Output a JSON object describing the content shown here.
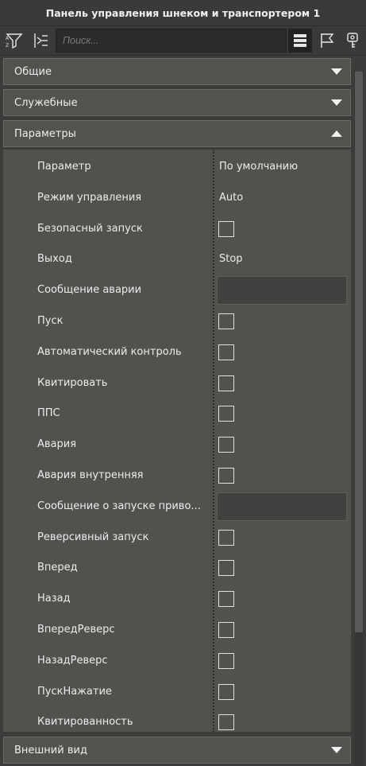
{
  "window": {
    "title": "Панель управления шнеком и транспортером 1"
  },
  "toolbar": {
    "search": {
      "placeholder": "Поиск..."
    },
    "buttons": [
      "sort-filter-icon",
      "expand-collapse-icon",
      "list-view-icon",
      "flag-icon",
      "key-icon"
    ]
  },
  "sections": {
    "general": {
      "label": "Общие",
      "expanded": false
    },
    "service": {
      "label": "Служебные",
      "expanded": false
    },
    "parameters": {
      "label": "Параметры",
      "expanded": true
    },
    "appearance": {
      "label": "Внешний вид",
      "expanded": false
    }
  },
  "grid": {
    "rows": [
      {
        "name": "Параметр",
        "type": "text",
        "value": "По умолчанию"
      },
      {
        "name": "Режим управления",
        "type": "text",
        "value": "Auto"
      },
      {
        "name": "Безопасный запуск",
        "type": "checkbox",
        "checked": false
      },
      {
        "name": "Выход",
        "type": "text",
        "value": "Stop"
      },
      {
        "name": "Сообщение аварии",
        "type": "field",
        "value": ""
      },
      {
        "name": "Пуск",
        "type": "checkbox",
        "checked": false
      },
      {
        "name": "Автоматический контроль",
        "type": "checkbox",
        "checked": false
      },
      {
        "name": "Квитировать",
        "type": "checkbox",
        "checked": false
      },
      {
        "name": "ППС",
        "type": "checkbox",
        "checked": false
      },
      {
        "name": "Авария",
        "type": "checkbox",
        "checked": false
      },
      {
        "name": "Авария внутренняя",
        "type": "checkbox",
        "checked": false
      },
      {
        "name": "Сообщение о запуске приво...",
        "type": "field",
        "value": ""
      },
      {
        "name": "Реверсивный запуск",
        "type": "checkbox",
        "checked": false
      },
      {
        "name": "Вперед",
        "type": "checkbox",
        "checked": false
      },
      {
        "name": "Назад",
        "type": "checkbox",
        "checked": false
      },
      {
        "name": "ВпередРеверс",
        "type": "checkbox",
        "checked": false
      },
      {
        "name": "НазадРеверс",
        "type": "checkbox",
        "checked": false
      },
      {
        "name": "ПускНажатие",
        "type": "checkbox",
        "checked": false
      },
      {
        "name": "Квитированность",
        "type": "checkbox",
        "checked": false
      }
    ]
  },
  "colors": {
    "background": "#3c3c3a",
    "section": "#52524f",
    "grid": "#51514e",
    "text": "#ececec"
  }
}
